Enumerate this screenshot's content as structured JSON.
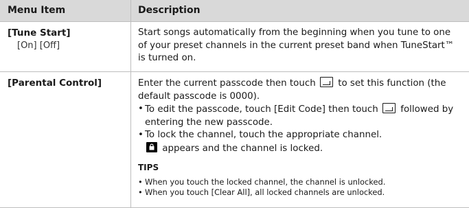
{
  "header": {
    "col1": "Menu Item",
    "col2": "Description"
  },
  "rows": [
    {
      "item": "[Tune Start]",
      "options": "[On] [Off]",
      "desc": "Start songs automatically from the beginning when you tune to one of your preset channels in the current preset band when TuneStart™ is turned on."
    },
    {
      "item": "[Parental Control]",
      "desc_a": "Enter the current passcode then touch",
      "desc_b": "to set this function (the default passcode is 0000).",
      "bullet1_a": "To edit the passcode, touch [Edit Code] then touch",
      "bullet1_b": "followed by entering the new passcode.",
      "bullet2_a": "To lock the channel, touch the appropriate channel.",
      "bullet2_b": "appears and the channel is locked.",
      "tips_title": "TIPS",
      "tips": [
        "When you touch the locked channel, the channel is unlocked.",
        "When you touch [Clear All], all locked channels are unlocked."
      ]
    }
  ],
  "icons": {
    "enter": "enter-key-icon",
    "lock": "lock-icon"
  }
}
